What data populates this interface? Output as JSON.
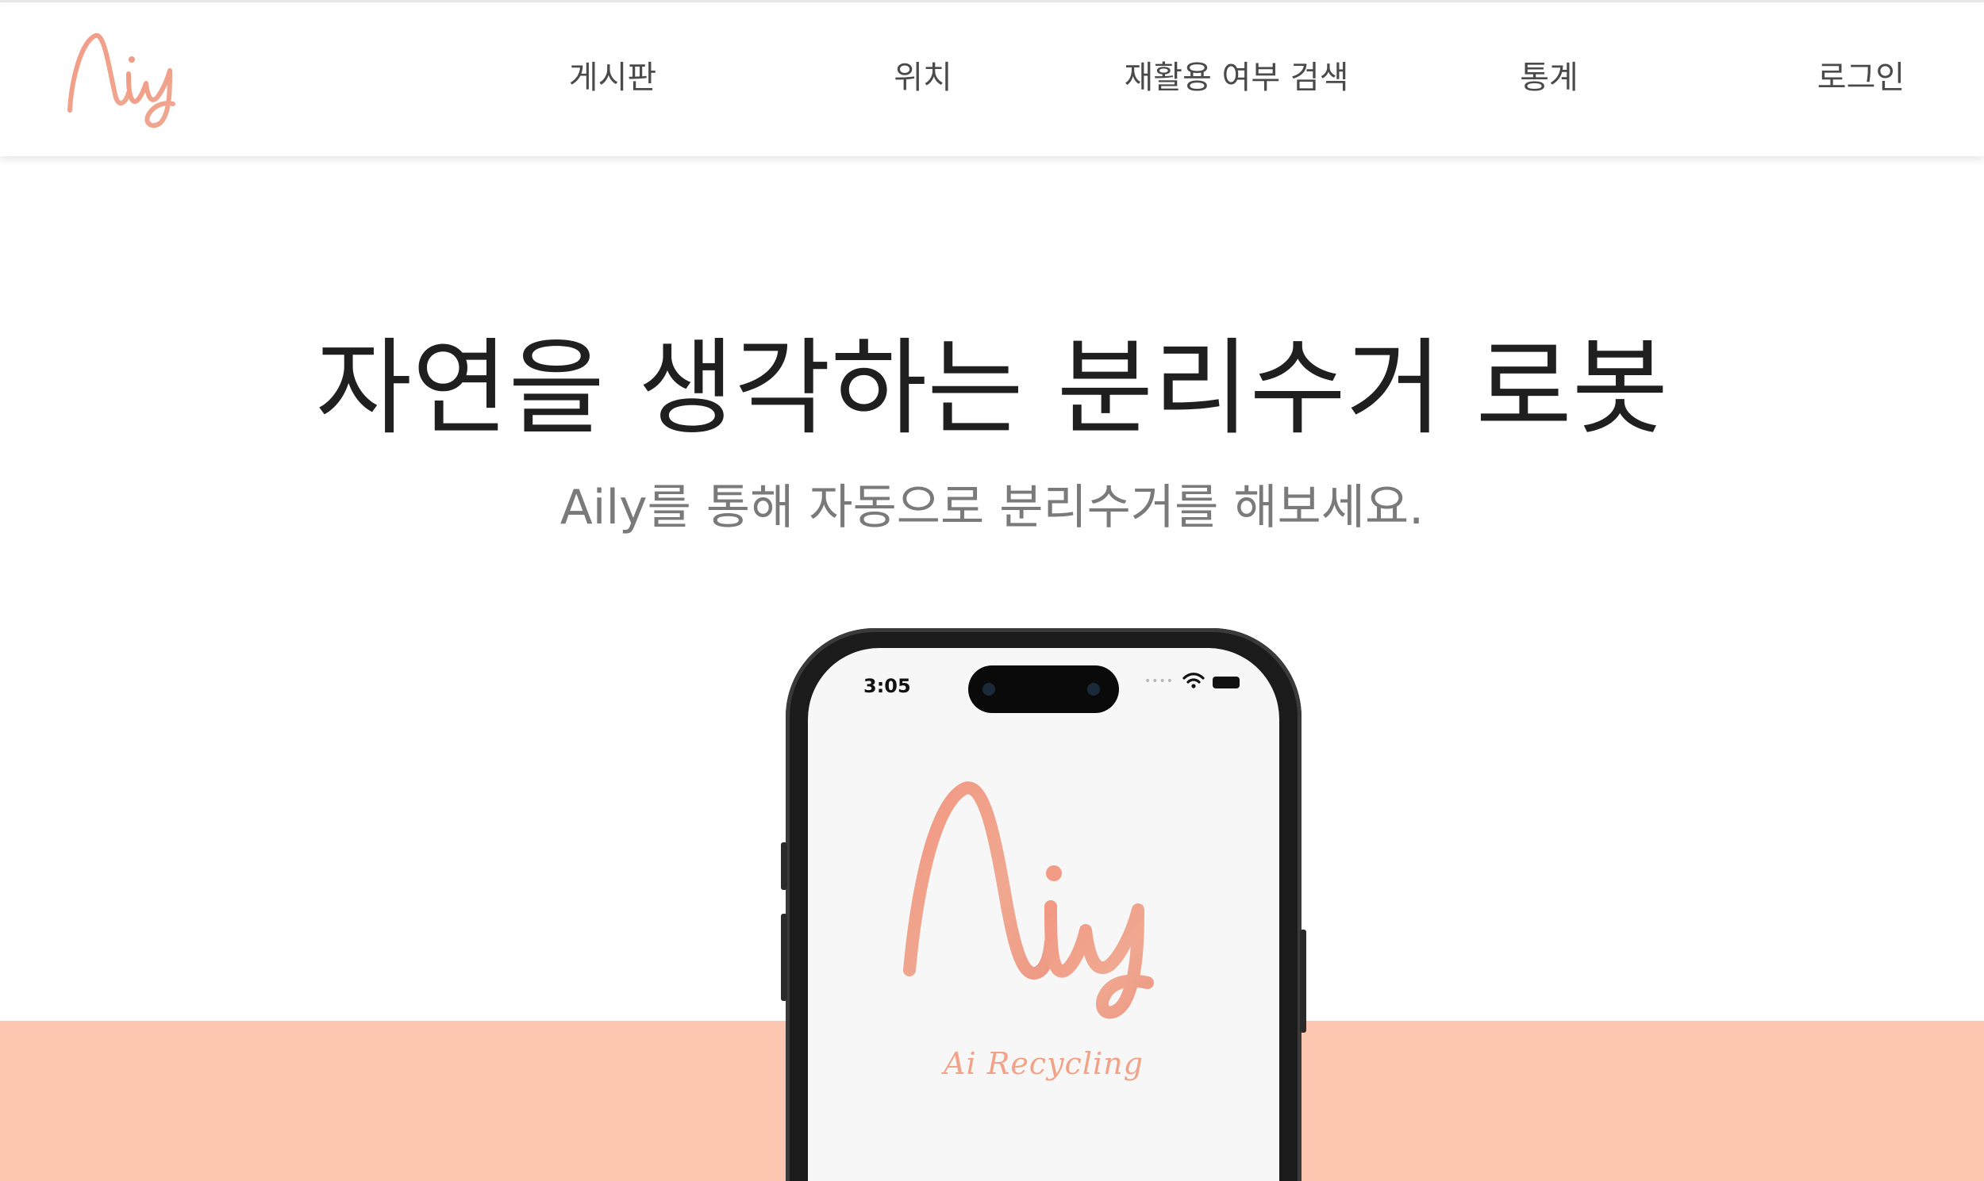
{
  "brand": {
    "logo_icon": "aily-logo",
    "accent_color": "#f0a08a"
  },
  "nav": {
    "items": [
      {
        "label": "게시판"
      },
      {
        "label": "위치"
      },
      {
        "label": "재활용 여부 검색"
      },
      {
        "label": "통계"
      },
      {
        "label": "로그인"
      }
    ]
  },
  "hero": {
    "title": "자연을 생각하는 분리수거 로봇",
    "subtitle": "Aily를 통해 자동으로 분리수거를 해보세요."
  },
  "phone": {
    "status_time": "3:05",
    "app_tagline": "Ai Recycling",
    "app_logo_icon": "aily-logo"
  },
  "colors": {
    "band": "#fcc6b1",
    "title": "#1f1f1f",
    "subtitle": "#7a7a7a"
  }
}
